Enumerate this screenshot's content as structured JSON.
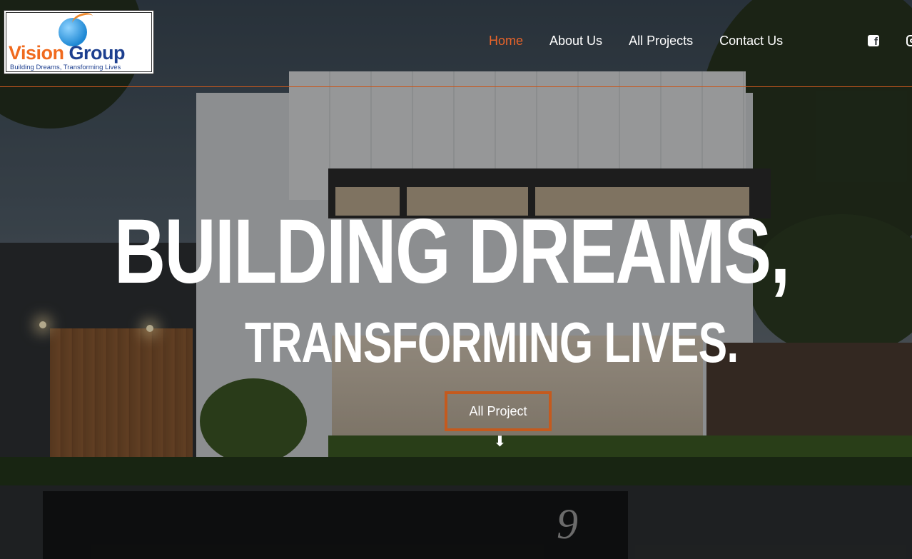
{
  "brand": {
    "name_part1": "Vision",
    "name_part2": "Group",
    "tagline": "Building Dreams, Transforming Lives"
  },
  "nav": {
    "items": [
      {
        "label": "Home",
        "active": true
      },
      {
        "label": "About Us",
        "active": false
      },
      {
        "label": "All Projects",
        "active": false
      },
      {
        "label": "Contact Us",
        "active": false
      }
    ]
  },
  "social": {
    "facebook_icon": "facebook-icon",
    "instagram_icon": "instagram-icon"
  },
  "hero": {
    "title": "BUILDING DREAMS,",
    "subtitle": "TRANSFORMING LIVES.",
    "cta_label": "All Project",
    "scroll_icon": "arrow-down-icon",
    "house_number": "9"
  },
  "colors": {
    "accent": "#e8642a",
    "cta_border": "#c45a1e",
    "logo_orange": "#f06a1e",
    "logo_blue": "#1d3f8f"
  }
}
